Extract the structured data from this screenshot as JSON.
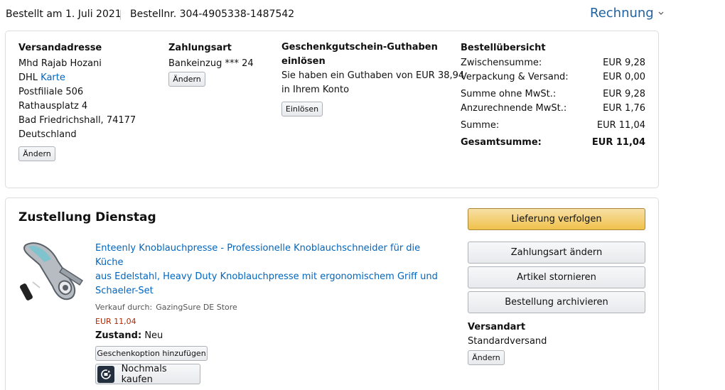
{
  "header": {
    "order_date": "Bestellt am 1. Juli 2021",
    "order_number": "Bestellnr. 304-4905338-1487542",
    "invoice_label": "Rechnung"
  },
  "shipping_address": {
    "heading": "Versandadresse",
    "name": "Mhd Rajab Hozani",
    "carrier": "DHL",
    "carrier_link": "Karte",
    "line1": "Postfiliale 506",
    "line2": "Rathausplatz 4",
    "line3": "Bad Friedrichshall, 74177",
    "country": "Deutschland",
    "change_label": "Ändern"
  },
  "payment": {
    "heading": "Zahlungsart",
    "method": "Bankeinzug *** 24",
    "change_label": "Ändern"
  },
  "gift_card": {
    "heading_line1": "Geschenkgutschein-Guthaben",
    "heading_line2": "einlösen",
    "text_line1": "Sie haben ein Guthaben von EUR 38,94",
    "text_line2": "in Ihrem Konto",
    "redeem_label": "Einlösen"
  },
  "summary": {
    "heading": "Bestellübersicht",
    "rows": [
      {
        "label": "Zwischensumme:",
        "value": "EUR 9,28"
      },
      {
        "label": "Verpackung & Versand:",
        "value": "EUR 0,00"
      },
      {
        "label": "Summe ohne MwSt.:",
        "value": "EUR 9,28"
      },
      {
        "label": "Anzurechnende MwSt.:",
        "value": "EUR 1,76"
      },
      {
        "label": "Summe:",
        "value": "EUR 11,04"
      }
    ],
    "total_label": "Gesamtsumme:",
    "total_value": "EUR 11,04"
  },
  "delivery": {
    "heading": "Zustellung Dienstag",
    "product_title_line1": "Enteenly Knoblauchpresse - Professionelle Knoblauchschneider für die Küche",
    "product_title_line2": "aus Edelstahl, Heavy Duty Knoblauchpresse mit ergonomischem Griff und",
    "product_title_line3": "Schaeler-Set",
    "sold_by_label": "Verkauf durch:",
    "seller": "GazingSure DE Store",
    "price": "EUR 11,04",
    "condition_label": "Zustand:",
    "condition_value": "Neu",
    "gift_option_label": "Geschenkoption hinzufügen",
    "buy_again_label": "Nochmals kaufen",
    "icon_buy_again": "reorder-icon"
  },
  "actions": {
    "track_label": "Lieferung verfolgen",
    "change_payment_label": "Zahlungsart ändern",
    "cancel_label": "Artikel stornieren",
    "archive_label": "Bestellung archivieren",
    "shipping_method_heading": "Versandart",
    "shipping_method_value": "Standardversand",
    "change_label": "Ändern"
  },
  "colors": {
    "link": "#0066c0",
    "invoice": "#2162a1",
    "price": "#b12704",
    "primary_button": "#f0c14b"
  }
}
